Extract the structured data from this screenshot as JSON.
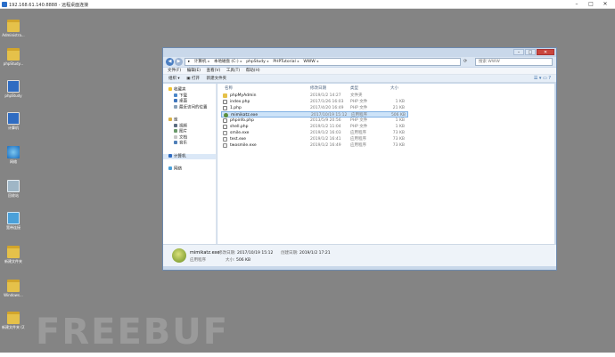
{
  "window": {
    "title": "192.168.61.140:8888 - 远程桌面连接"
  },
  "desktop_icons": [
    {
      "label": "Administra...",
      "icon": "folder-icon"
    },
    {
      "label": "phpStudy...",
      "icon": "folder-icon"
    },
    {
      "label": "phpStudy",
      "icon": "computer-icon"
    },
    {
      "label": "计算机",
      "icon": "computer-icon"
    },
    {
      "label": "网络",
      "icon": "globe-icon"
    },
    {
      "label": "回收站",
      "icon": "recycle-bin-icon"
    },
    {
      "label": "宽带连接",
      "icon": "network-icon"
    },
    {
      "label": "新建文件夹",
      "icon": "folder-icon"
    },
    {
      "label": "Windows...",
      "icon": "folder-icon"
    },
    {
      "label": "新建文件夹 (2)",
      "icon": "folder-icon"
    }
  ],
  "watermark": "FREEBUF",
  "explorer": {
    "breadcrumb": [
      "计算机",
      "本地磁盘 (C:)",
      "phpStudy",
      "PHPTutorial",
      "WWW"
    ],
    "search_placeholder": "搜索 WWW",
    "menu": [
      "文件(F)",
      "编辑(E)",
      "查看(V)",
      "工具(T)",
      "帮助(H)"
    ],
    "toolbar": [
      "组织 ▾",
      "打开",
      "新建文件夹"
    ],
    "nav": {
      "favorites": {
        "label": "收藏夹",
        "items": [
          "下载",
          "桌面",
          "最近访问的位置"
        ]
      },
      "libraries": {
        "label": "库",
        "items": [
          "视频",
          "图片",
          "文档",
          "音乐"
        ]
      },
      "computer": "计算机",
      "network": "网络"
    },
    "columns": {
      "name": "名称",
      "date": "修改日期",
      "type": "类型",
      "size": "大小"
    },
    "files": [
      {
        "name": "phpMyAdmin",
        "date": "2019/1/2 14:27",
        "type": "文件夹",
        "size": "",
        "icon": "folder-icon"
      },
      {
        "name": "index.php",
        "date": "2017/1/26 16:03",
        "type": "PHP 文件",
        "size": "1 KB",
        "icon": "php-file-icon"
      },
      {
        "name": "1.php",
        "date": "2017/4/20 16:49",
        "type": "PHP 文件",
        "size": "21 KB",
        "icon": "php-file-icon"
      },
      {
        "name": "mimikatz.exe",
        "date": "2017/10/19 15:12",
        "type": "应用程序",
        "size": "506 KB",
        "icon": "mimikatz-icon",
        "selected": true
      },
      {
        "name": "phpinfo.php",
        "date": "2013/5/9 20:56",
        "type": "PHP 文件",
        "size": "1 KB",
        "icon": "php-file-icon"
      },
      {
        "name": "shell.php",
        "date": "2019/1/2 11:04",
        "type": "PHP 文件",
        "size": "1 KB",
        "icon": "php-file-icon"
      },
      {
        "name": "smile.exe",
        "date": "2019/1/2 16:03",
        "type": "应用程序",
        "size": "73 KB",
        "icon": "app-icon"
      },
      {
        "name": "test.exe",
        "date": "2019/1/2 16:41",
        "type": "应用程序",
        "size": "73 KB",
        "icon": "app-icon"
      },
      {
        "name": "twosmile.exe",
        "date": "2019/1/2 16:49",
        "type": "应用程序",
        "size": "73 KB",
        "icon": "app-icon"
      }
    ],
    "details": {
      "name": "mimikatz.exe",
      "type": "应用程序",
      "modified_label": "修改日期:",
      "modified": "2017/10/19 15:12",
      "created_label": "创建日期:",
      "created": "2019/1/2 17:21",
      "size_label": "大小:",
      "size": "506 KB"
    }
  }
}
